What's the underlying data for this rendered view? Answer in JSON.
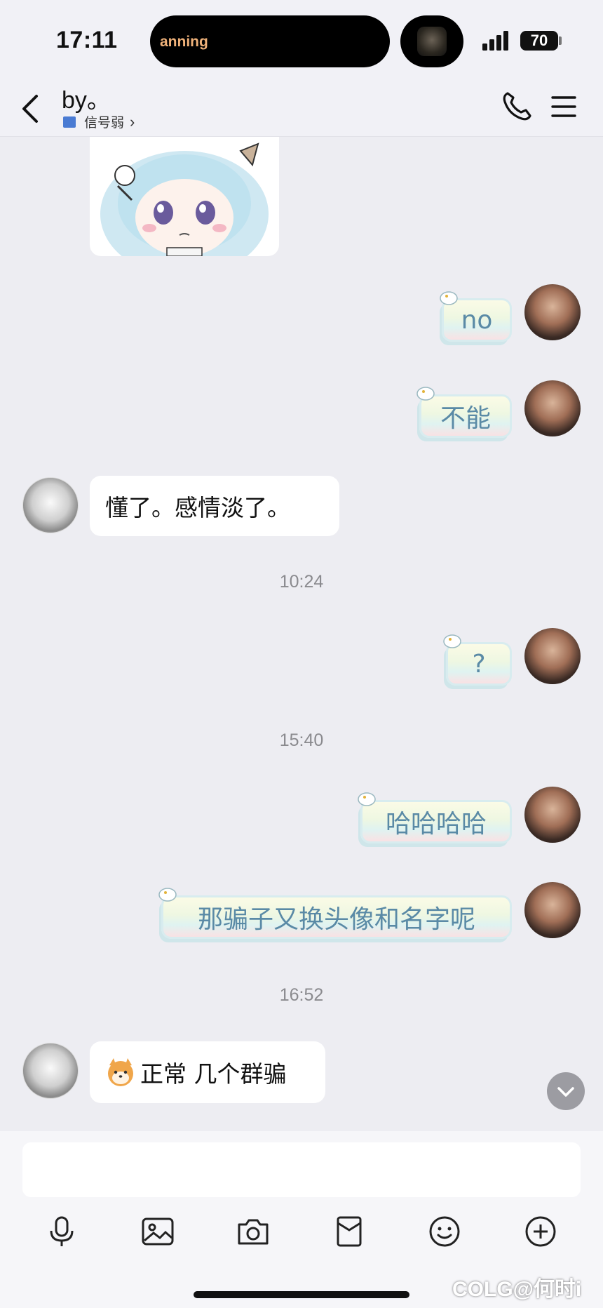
{
  "status_bar": {
    "time": "17:11",
    "island_text": "anning",
    "battery": "70"
  },
  "header": {
    "title": "by。",
    "network_status": "信号弱",
    "icons": [
      "back-icon",
      "phone-icon",
      "menu-icon"
    ]
  },
  "messages": [
    {
      "side": "them",
      "type": "sticker",
      "icon": "anime-girl-sticker"
    },
    {
      "side": "me",
      "text": "no"
    },
    {
      "side": "me",
      "text": "不能"
    },
    {
      "side": "them",
      "text": "懂了。感情淡了。"
    },
    {
      "side": "system",
      "text": "10:24"
    },
    {
      "side": "me",
      "text": "?"
    },
    {
      "side": "system",
      "text": "15:40"
    },
    {
      "side": "me",
      "text": "哈哈哈哈"
    },
    {
      "side": "me",
      "text": "那骗子又换头像和名字呢"
    },
    {
      "side": "system",
      "text": "16:52"
    },
    {
      "side": "them",
      "text": "正常 几个群骗",
      "icon": "shiba-emoji"
    }
  ],
  "input": {
    "value": ""
  },
  "toolbar": [
    "mic-icon",
    "image-icon",
    "camera-icon",
    "red-packet-icon",
    "emoji-icon",
    "plus-icon"
  ],
  "watermark": "COLG@何时i",
  "colors": {
    "background": "#ededf2",
    "bubble_text_me": "#5a8aa6",
    "bubble_them": "#ffffff",
    "timestamp": "#8a8a8e"
  }
}
